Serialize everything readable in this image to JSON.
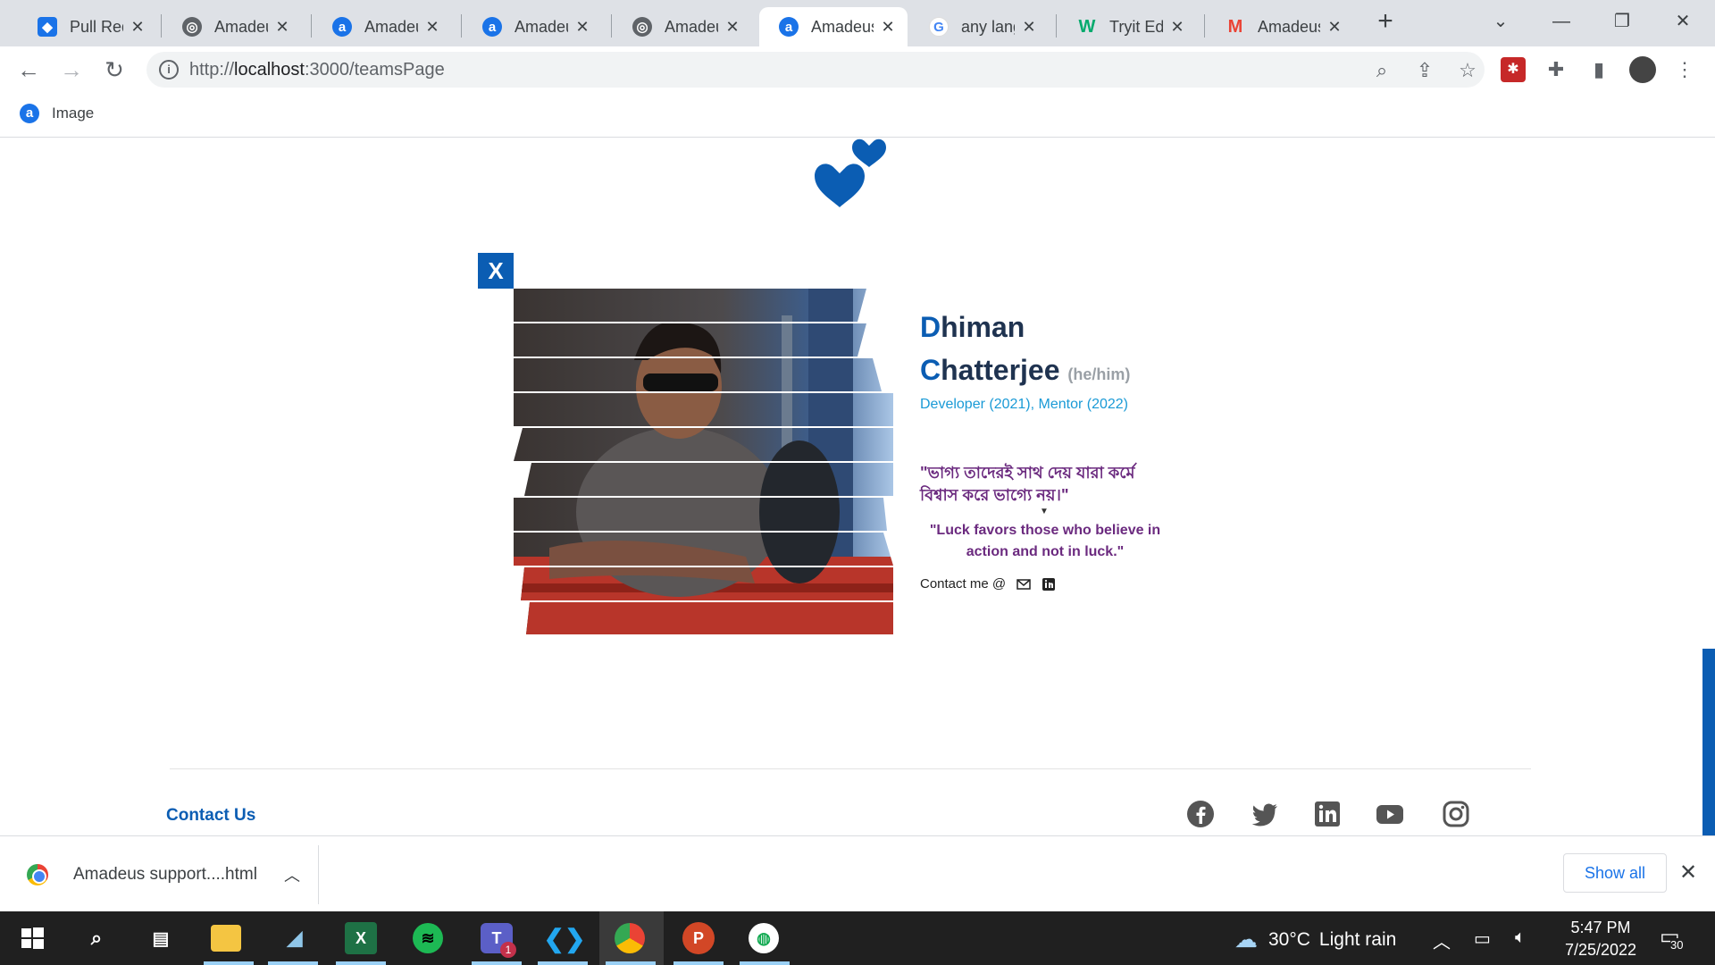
{
  "browser": {
    "tabs": [
      {
        "title": "Pull Requ",
        "icon": "shield-tab-icon",
        "color": "#1a73e8",
        "active": false
      },
      {
        "title": "Amadeus",
        "icon": "globe-tab-icon",
        "color": "#5f6368",
        "active": false
      },
      {
        "title": "Amadeus",
        "icon": "amadeus-tab-icon",
        "color": "#1a73e8",
        "active": false
      },
      {
        "title": "Amadeus",
        "icon": "amadeus-tab-icon",
        "color": "#1a73e8",
        "active": false
      },
      {
        "title": "Amadeus",
        "icon": "globe-tab-icon",
        "color": "#5f6368",
        "active": false
      },
      {
        "title": "Amadeus",
        "icon": "amadeus-tab-icon",
        "color": "#1a73e8",
        "active": true
      },
      {
        "title": "any lang",
        "icon": "google-tab-icon",
        "color": "#4285f4",
        "active": false
      },
      {
        "title": "Tryit Edit",
        "icon": "w3schools-tab-icon",
        "color": "#04aa6d",
        "active": false
      },
      {
        "title": "Amadeus",
        "icon": "gmail-tab-icon",
        "color": "#ea4335",
        "active": false
      }
    ],
    "url": {
      "scheme": "http://",
      "host": "localhost",
      "path": ":3000/teamsPage"
    },
    "bookmark": {
      "label": "Image"
    }
  },
  "profile": {
    "first_initial": "D",
    "first_rest": "himan",
    "last_initial": "C",
    "last_rest": "hatterjee",
    "pronouns": "(he/him)",
    "roles": "Developer (2021), Mentor (2022)",
    "quote_bengali": "\"ভাগ্য তাদেরই সাথ দেয় যারা কর্মে বিশ্বাস করে ভাগ্যে নয়।\"",
    "quote_english": "\"Luck favors those who believe in action and not in luck.\"",
    "contact_label": "Contact me @",
    "close_label": "X"
  },
  "footer": {
    "contact_us": "Contact Us",
    "socials": [
      "facebook-icon",
      "twitter-icon",
      "linkedin-icon",
      "youtube-icon",
      "instagram-icon"
    ]
  },
  "download_bar": {
    "file_name": "Amadeus support....html",
    "show_all": "Show all"
  },
  "taskbar": {
    "weather_temp": "30°C",
    "weather_desc": "Light rain",
    "time": "5:47 PM",
    "date": "7/25/2022",
    "notification_count": "30",
    "teams_badge": "1"
  },
  "colors": {
    "accent": "#0b5db3",
    "role_text": "#1a9ad6",
    "quote_text": "#6b2a7f"
  }
}
